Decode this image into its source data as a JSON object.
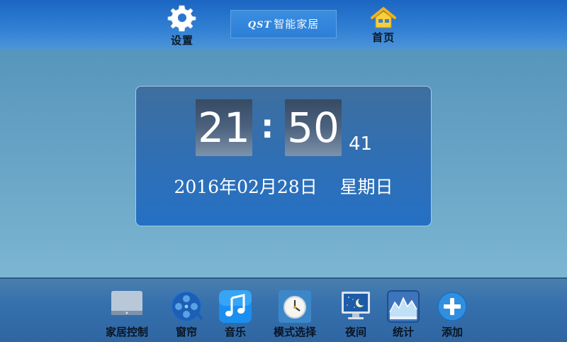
{
  "topbar": {
    "settings_label": "设置",
    "home_label": "首页",
    "brand_prefix": "QST",
    "brand_name": "智能家居"
  },
  "clock": {
    "hours": "21",
    "colon": ":",
    "minutes": "50",
    "seconds": "41",
    "date_text": "2016年02月28日    星期日"
  },
  "dock": {
    "items": [
      {
        "label": "家居控制",
        "icon": "monitor-icon"
      },
      {
        "label": "窗帘",
        "icon": "film-reel-icon"
      },
      {
        "label": "音乐",
        "icon": "music-note-icon"
      },
      {
        "label": "模式选择",
        "icon": "clock-icon"
      },
      {
        "label": "夜间",
        "icon": "night-moon-icon"
      },
      {
        "label": "统计",
        "icon": "chart-icon"
      },
      {
        "label": "添加",
        "icon": "plus-icon"
      }
    ]
  },
  "colors": {
    "topbar": "#2f7ed4",
    "panel": "#2f6fb5",
    "dock": "#3570ad"
  }
}
